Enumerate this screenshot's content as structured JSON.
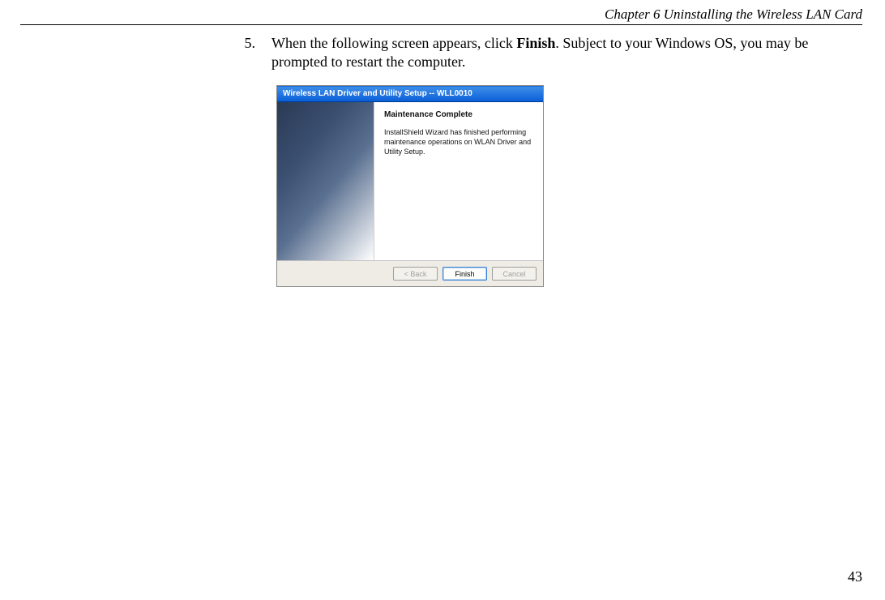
{
  "header": {
    "chapterTitle": "Chapter 6    Uninstalling the Wireless LAN Card"
  },
  "instruction": {
    "number": "5.",
    "textPrefix": "When the following screen appears, click ",
    "boldWord": "Finish",
    "textSuffix": ". Subject to your Windows OS, you may be prompted to restart the computer."
  },
  "dialog": {
    "title": "Wireless LAN Driver and Utility Setup -- WLL0010",
    "heading": "Maintenance Complete",
    "body": "InstallShield Wizard has finished performing maintenance operations on WLAN Driver and Utility Setup.",
    "buttons": {
      "back": "< Back",
      "finish": "Finish",
      "cancel": "Cancel"
    }
  },
  "pageNumber": "43"
}
